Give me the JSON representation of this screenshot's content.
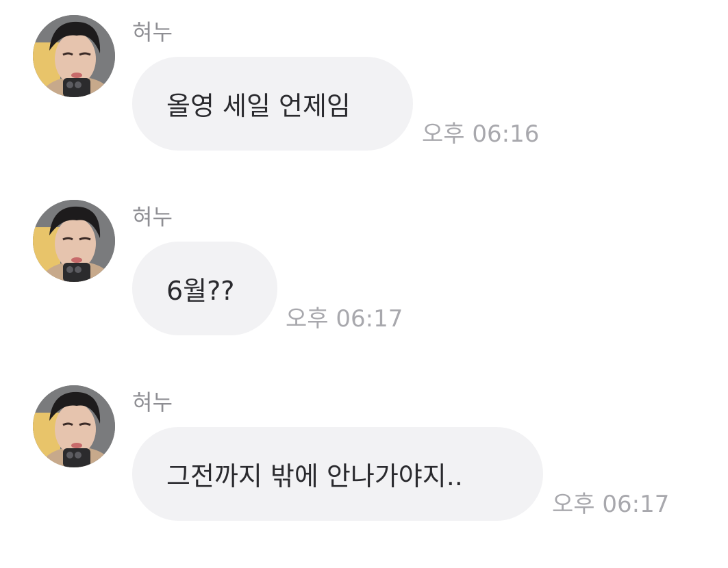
{
  "messages": [
    {
      "sender": "혀누",
      "text": "올영 세일 언제임",
      "time": "오후 06:16"
    },
    {
      "sender": "혀누",
      "text": "6월??",
      "time": "오후 06:17"
    },
    {
      "sender": "혀누",
      "text": "그전까지 밖에 안나가야지..",
      "time": "오후 06:17"
    }
  ],
  "colors": {
    "bubble": "#f2f2f4",
    "message_text": "#2a2a2e",
    "sender_text": "#8e8e93",
    "time_text": "#a8a8ad"
  }
}
